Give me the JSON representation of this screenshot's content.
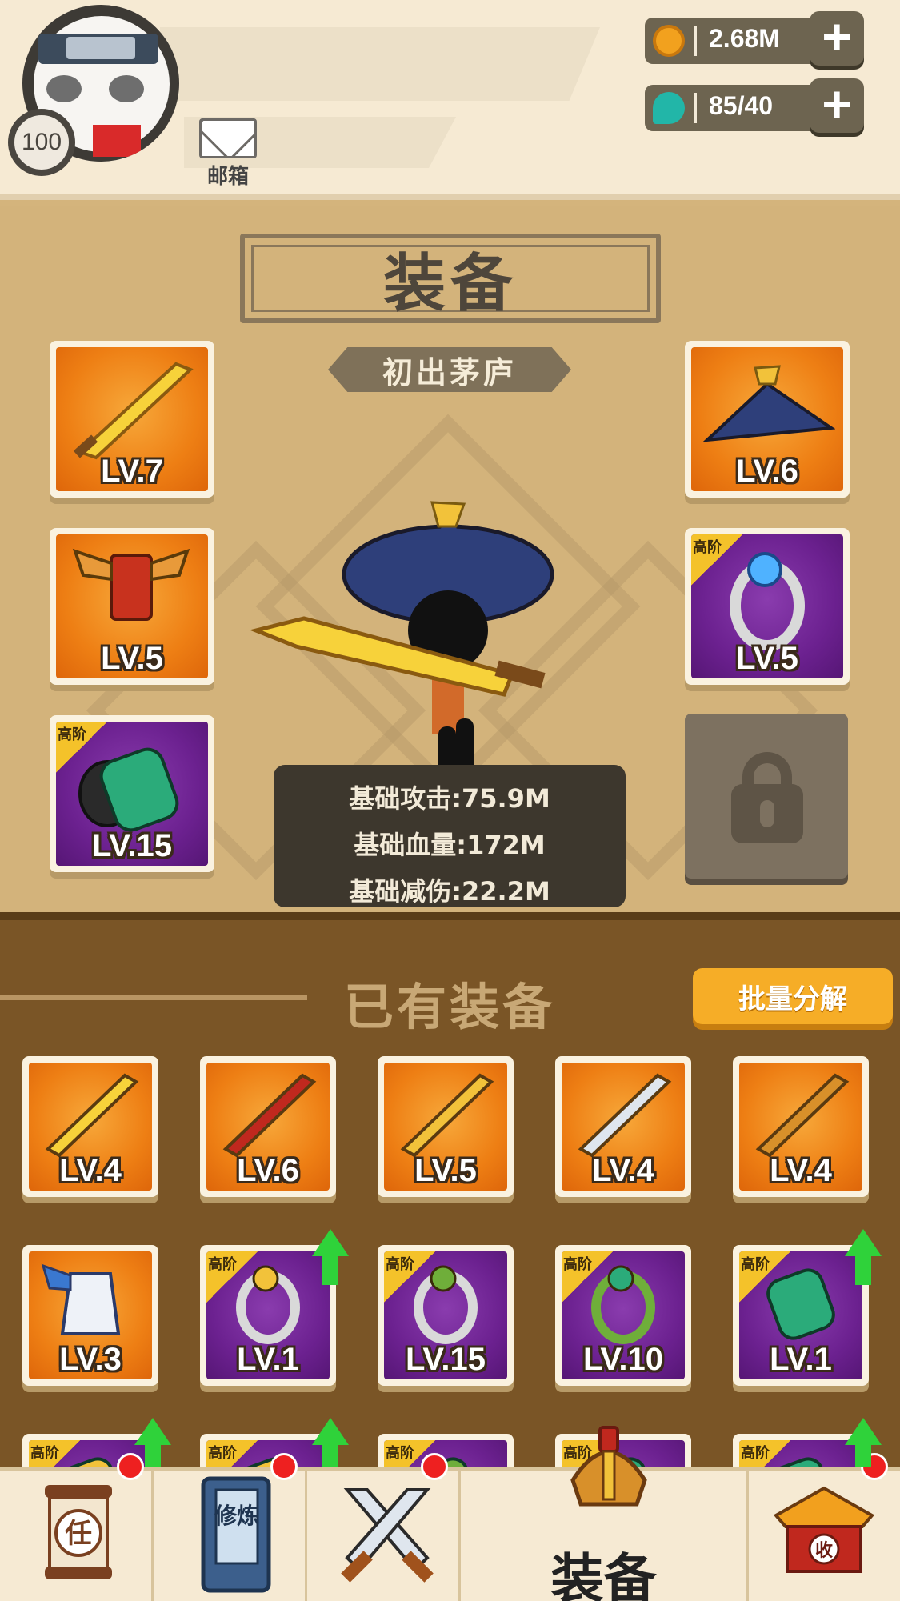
{
  "header": {
    "level": "100",
    "mail_label": "邮箱",
    "gold": "2.68M",
    "gems": "85/40",
    "plus": "+"
  },
  "equip": {
    "title": "装备",
    "subtitle": "初出茅庐",
    "slots_left": [
      {
        "level": "LV.7",
        "rarity": "orange",
        "tier": "",
        "icon": "golden-sword-icon"
      },
      {
        "level": "LV.5",
        "rarity": "orange",
        "tier": "",
        "icon": "red-armor-icon"
      },
      {
        "level": "LV.15",
        "rarity": "purple",
        "tier": "高阶",
        "icon": "green-bracer-icon"
      }
    ],
    "slots_right": [
      {
        "level": "LV.6",
        "rarity": "orange",
        "tier": "",
        "icon": "straw-hat-icon"
      },
      {
        "level": "LV.5",
        "rarity": "purple",
        "tier": "高阶",
        "icon": "blue-gem-ring-icon"
      }
    ],
    "stats": [
      "基础攻击:75.9M",
      "基础血量:172M",
      "基础减伤:22.2M"
    ]
  },
  "inventory": {
    "title": "已有装备",
    "batch_button": "批量分解",
    "items": [
      {
        "level": "LV.4",
        "rarity": "orange",
        "tier": "",
        "upgrade": false,
        "icon": "mace-icon"
      },
      {
        "level": "LV.6",
        "rarity": "orange",
        "tier": "",
        "upgrade": false,
        "icon": "staff-icon"
      },
      {
        "level": "LV.5",
        "rarity": "orange",
        "tier": "",
        "upgrade": false,
        "icon": "spear-icon"
      },
      {
        "level": "LV.4",
        "rarity": "orange",
        "tier": "",
        "upgrade": false,
        "icon": "blue-sword-icon"
      },
      {
        "level": "LV.4",
        "rarity": "orange",
        "tier": "",
        "upgrade": false,
        "icon": "key-blade-icon"
      },
      {
        "level": "LV.3",
        "rarity": "orange",
        "tier": "",
        "upgrade": false,
        "icon": "blue-robe-icon"
      },
      {
        "level": "LV.1",
        "rarity": "purple",
        "tier": "高阶",
        "upgrade": true,
        "icon": "gold-ring-icon"
      },
      {
        "level": "LV.15",
        "rarity": "purple",
        "tier": "高阶",
        "upgrade": false,
        "icon": "gold-ring-icon"
      },
      {
        "level": "LV.10",
        "rarity": "purple",
        "tier": "高阶",
        "upgrade": false,
        "icon": "green-bracelet-icon"
      },
      {
        "level": "LV.1",
        "rarity": "purple",
        "tier": "高阶",
        "upgrade": true,
        "icon": "green-bracer-icon"
      },
      {
        "level": "",
        "rarity": "purple",
        "tier": "高阶",
        "upgrade": true,
        "icon": "item-icon"
      },
      {
        "level": "",
        "rarity": "purple",
        "tier": "高阶",
        "upgrade": true,
        "icon": "item-icon"
      },
      {
        "level": "",
        "rarity": "purple",
        "tier": "高阶",
        "upgrade": false,
        "icon": "item-icon"
      },
      {
        "level": "",
        "rarity": "purple",
        "tier": "高阶",
        "upgrade": false,
        "icon": "item-icon"
      },
      {
        "level": "",
        "rarity": "purple",
        "tier": "高阶",
        "upgrade": true,
        "icon": "item-icon"
      }
    ]
  },
  "nav": {
    "tasks_glyph": "任",
    "training_glyph": "修炼",
    "equip_label": "装备",
    "collect_glyph": "收"
  },
  "colors": {
    "orange_card": "#ee7f14",
    "purple_card": "#6c2190",
    "upgrade_arrow": "#2fd23a",
    "notification": "#ee2020",
    "button": "#f6ad27"
  }
}
